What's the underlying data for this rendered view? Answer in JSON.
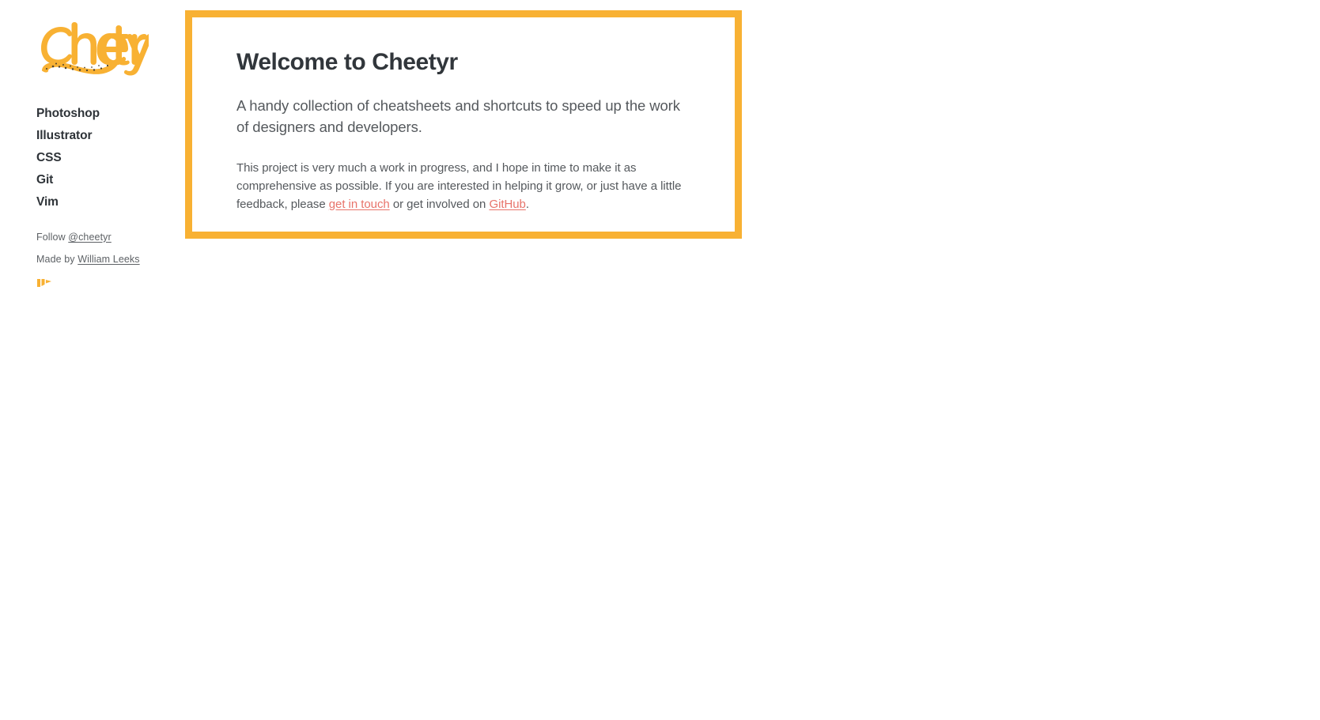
{
  "brand": {
    "name": "Cheetyr",
    "logo_icon": "cheetyr-wordmark-logo",
    "accent_color": "#f8b133",
    "link_color": "#e8736a",
    "text_color": "#55595d"
  },
  "sidebar": {
    "nav_items": [
      {
        "label": "Photoshop",
        "name": "sidebar-item-photoshop"
      },
      {
        "label": "Illustrator",
        "name": "sidebar-item-illustrator"
      },
      {
        "label": "CSS",
        "name": "sidebar-item-css"
      },
      {
        "label": "Git",
        "name": "sidebar-item-git"
      },
      {
        "label": "Vim",
        "name": "sidebar-item-vim"
      }
    ],
    "follow": {
      "prefix": "Follow ",
      "handle": "@cheetyr"
    },
    "made_by": {
      "prefix": "Made by ",
      "author": "William Leeks"
    },
    "maker_mark_icon": "maker-logo-mark"
  },
  "card": {
    "title": "Welcome to Cheetyr",
    "lead": "A handy collection of cheatsheets and shortcuts to speed up the work of designers and developers.",
    "body": {
      "part1": "This project is very much a work in progress, and I hope in time to make it as comprehensive as possible. If you are interested in helping it grow, or just have a little feedback, please ",
      "link1": "get in touch",
      "part2": " or get involved on ",
      "link2": "GitHub",
      "part3": "."
    }
  }
}
